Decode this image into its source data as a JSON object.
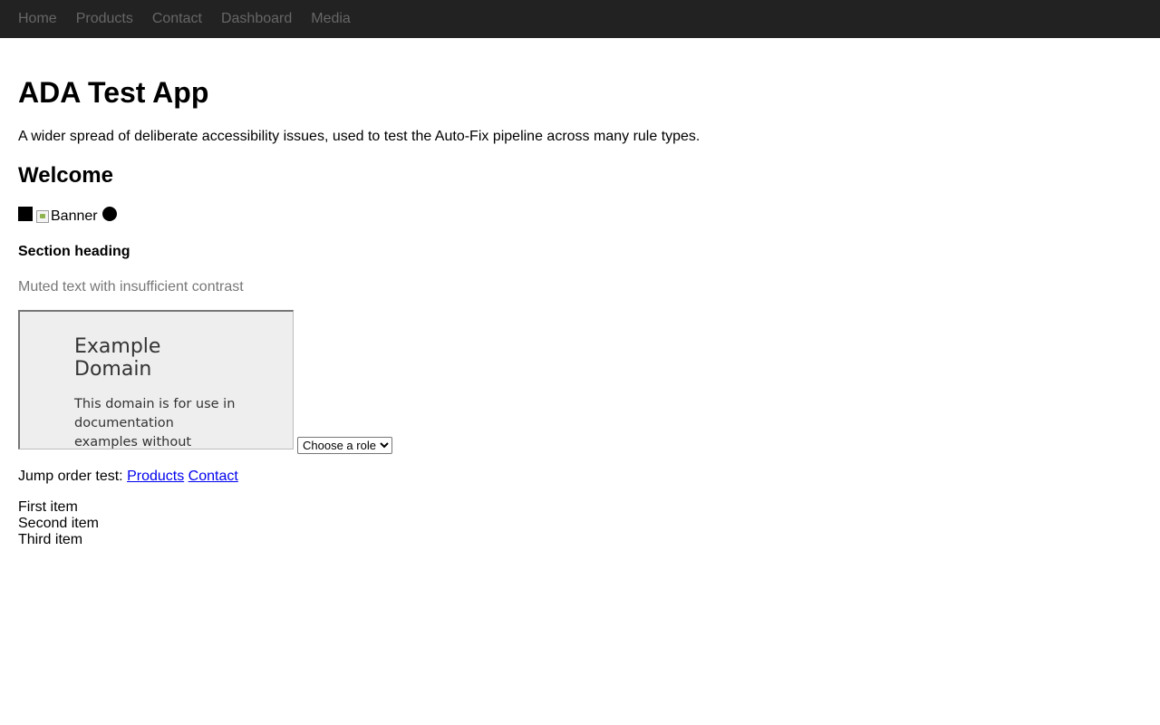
{
  "nav": {
    "items": [
      "Home",
      "Products",
      "Contact",
      "Dashboard",
      "Media"
    ]
  },
  "main": {
    "title": "ADA Test App",
    "intro": "A wider spread of deliberate accessibility issues, used to test the Auto-Fix pipeline across many rule types.",
    "welcome": "Welcome",
    "banner_alt": "Banner",
    "section_heading": "Section heading",
    "muted_text": "Muted text with insufficient contrast",
    "frame": {
      "title": "Example Domain",
      "text": "This domain is for use in documentation examples without needing permission. Avoid use in operations."
    },
    "role_select": {
      "selected": "Choose a role"
    },
    "jump": {
      "label": "Jump order test:",
      "links": [
        "Products",
        "Contact"
      ]
    },
    "list": [
      "First item",
      "Second item",
      "Third item"
    ]
  },
  "colors": {
    "nav_bg": "#222222",
    "nav_link": "#666666",
    "muted": "#777777",
    "link": "#0000ee"
  },
  "icons": [
    "black-square-icon",
    "broken-image-icon",
    "black-circle-icon"
  ]
}
